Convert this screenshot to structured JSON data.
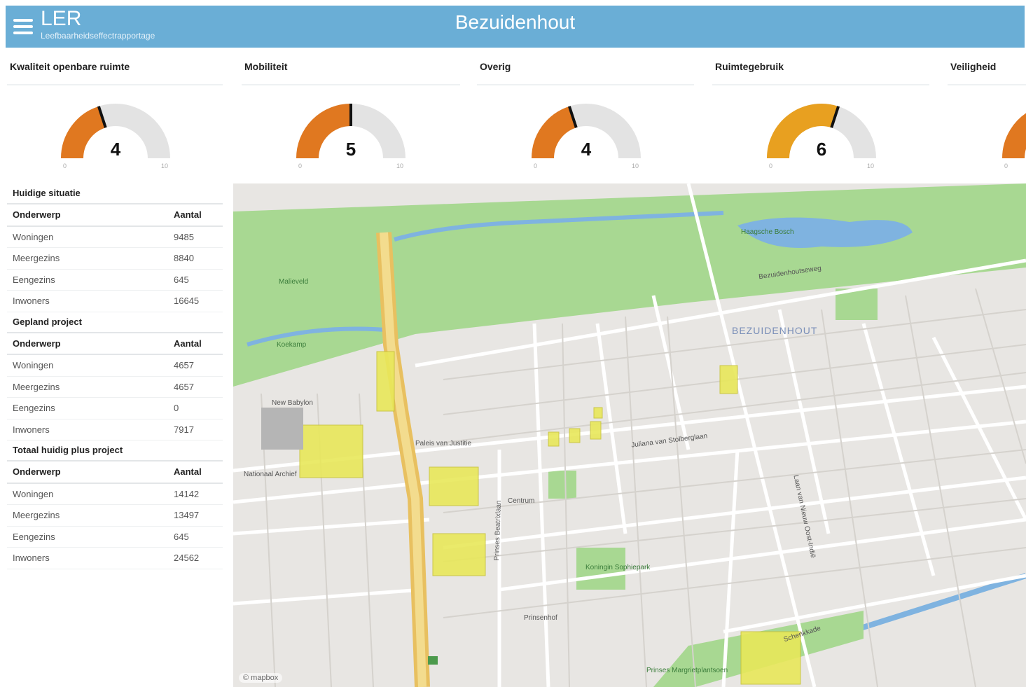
{
  "header": {
    "app_title": "LER",
    "app_subtitle": "Leefbaarheidseffectrapportage",
    "area_title": "Bezuidenhout"
  },
  "colors": {
    "header_bg": "#6aaed6",
    "gauge_orange": "#e07820",
    "gauge_amber": "#e8a020",
    "gauge_track": "#e3e3e3"
  },
  "gauges": [
    {
      "label": "Kwaliteit openbare ruimte",
      "value": "4",
      "min": "0",
      "max": "10",
      "fraction": 0.4,
      "color": "#e07820"
    },
    {
      "label": "Mobiliteit",
      "value": "5",
      "min": "0",
      "max": "10",
      "fraction": 0.5,
      "color": "#e07820"
    },
    {
      "label": "Overig",
      "value": "4",
      "min": "0",
      "max": "10",
      "fraction": 0.4,
      "color": "#e07820"
    },
    {
      "label": "Ruimtegebruik",
      "value": "6",
      "min": "0",
      "max": "10",
      "fraction": 0.6,
      "color": "#e8a020"
    },
    {
      "label": "Veiligheid",
      "min": "0",
      "color": "#e07820"
    }
  ],
  "stats": {
    "col_subject": "Onderwerp",
    "col_count": "Aantal",
    "sections": [
      {
        "title": "Huidige situatie",
        "rows": [
          {
            "label": "Woningen",
            "value": "9485"
          },
          {
            "label": "Meergezins",
            "value": "8840"
          },
          {
            "label": "Eengezins",
            "value": "645"
          },
          {
            "label": "Inwoners",
            "value": "16645"
          }
        ]
      },
      {
        "title": "Gepland project",
        "rows": [
          {
            "label": "Woningen",
            "value": "4657"
          },
          {
            "label": "Meergezins",
            "value": "4657"
          },
          {
            "label": "Eengezins",
            "value": "0"
          },
          {
            "label": "Inwoners",
            "value": "7917"
          }
        ]
      },
      {
        "title": "Totaal huidig plus project",
        "rows": [
          {
            "label": "Woningen",
            "value": "14142"
          },
          {
            "label": "Meergezins",
            "value": "13497"
          },
          {
            "label": "Eengezins",
            "value": "645"
          },
          {
            "label": "Inwoners",
            "value": "24562"
          }
        ]
      }
    ]
  },
  "map": {
    "district_label": "BEZUIDENHOUT",
    "labels": {
      "haagsche_bosch": "Haagsche Bosch",
      "malieveld": "Malieveld",
      "koekamp": "Koekamp",
      "koningin_sophiepark": "Koningin Sophiepark",
      "prinses_margrietplantsoen": "Prinses Margrietplantsoen",
      "juliana_van_stolberglaan": "Juliana van Stolberglaan",
      "laan_van_nieuw_oost_indie": "Laan van Nieuw Oost-Indië",
      "prinses_beatrixlaan": "Prinses Beatrixlaan",
      "schenkkade": "Schenkkade",
      "paleis_van_justitie": "Paleis van Justitie",
      "nationaal_archief": "Nationaal Archief",
      "new_babylon": "New Babylon",
      "prinsenhof": "Prinsenhof",
      "centrum": "Centrum",
      "bezuidenhoutseweg": "Bezuidenhoutseweg"
    },
    "attribution": "© mapbox"
  }
}
